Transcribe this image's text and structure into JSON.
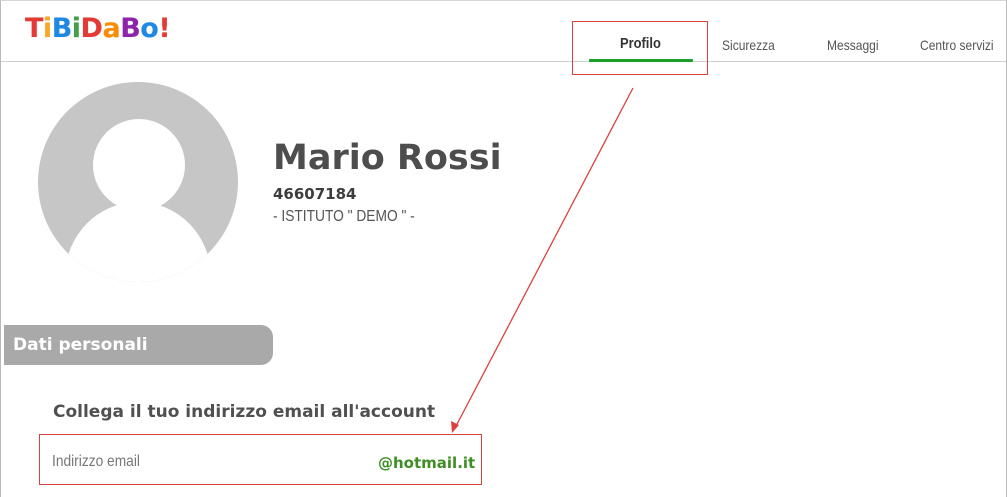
{
  "brand": {
    "logo_letters": [
      "T",
      "i",
      "B",
      "i",
      "D",
      "a",
      "B",
      "o",
      "!"
    ],
    "logo_colors": [
      "#e53935",
      "#f9a825",
      "#1e88e5",
      "#43a047",
      "#e53935",
      "#fb8c00",
      "#8e24aa",
      "#1e88e5",
      "#e53935"
    ]
  },
  "nav": {
    "items": [
      {
        "label": "Profilo"
      },
      {
        "label": "Sicurezza"
      },
      {
        "label": "Messaggi"
      },
      {
        "label": "Centro servizi"
      }
    ],
    "active_color": "#1ba12b"
  },
  "profile": {
    "avatar_icon": "user-silhouette-icon",
    "name": "Mario Rossi",
    "id": "46607184",
    "school": "- ISTITUTO \" DEMO \" -"
  },
  "section": {
    "title": "Dati personali"
  },
  "email_link": {
    "title": "Collega il tuo indirizzo email all'account",
    "placeholder": "Indirizzo email",
    "domain": "@hotmail.it"
  },
  "annotation": {
    "color": "#d9413f"
  }
}
